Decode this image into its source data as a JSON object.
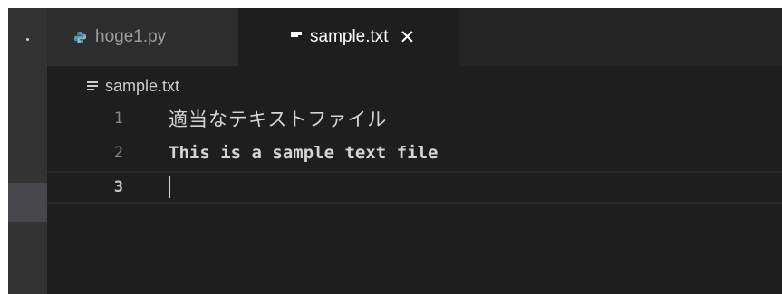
{
  "tabs": [
    {
      "label": "hoge1.py",
      "icon": "python-icon",
      "active": false
    },
    {
      "label": "sample.txt",
      "icon": "text-file-icon",
      "active": true,
      "close_glyph": "✕"
    }
  ],
  "breadcrumb": {
    "label": "sample.txt",
    "icon": "text-file-icon"
  },
  "editor": {
    "lines": [
      {
        "number": "1",
        "text": "適当なテキストファイル"
      },
      {
        "number": "2",
        "text": "This is a sample text file"
      },
      {
        "number": "3",
        "text": ""
      }
    ],
    "current_line": "3"
  },
  "colors": {
    "editor_bg": "#1e1e1e",
    "tab_bar_bg": "#252526",
    "inactive_tab_bg": "#2d2d2d",
    "activity_bar_bg": "#333333",
    "python_icon": "#519aba"
  }
}
